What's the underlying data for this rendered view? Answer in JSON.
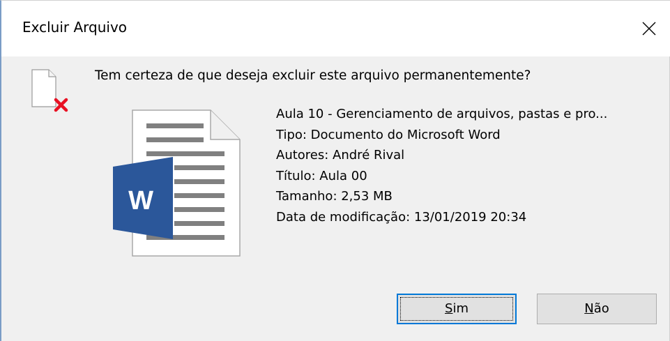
{
  "window": {
    "title": "Excluir Arquivo",
    "close_icon": "close-icon"
  },
  "message": {
    "question": "Tem certeza de que deseja excluir este arquivo permanentemente?",
    "icon": "delete-file-icon"
  },
  "file": {
    "icon": "word-document-icon",
    "name": "Aula 10 - Gerenciamento de arquivos, pastas e pro...",
    "type": "Tipo: Documento do Microsoft Word",
    "authors": "Autores: André Rival",
    "title": "Título: Aula 00",
    "size": "Tamanho: 2,53 MB",
    "modified": "Data de modificação: 13/01/2019 20:34"
  },
  "buttons": {
    "yes_mnemonic": "S",
    "yes_rest": "im",
    "no_mnemonic": "N",
    "no_rest": "ão"
  },
  "colors": {
    "accent": "#0078d7",
    "word_blue": "#2b579a",
    "delete_red": "#e81123"
  }
}
